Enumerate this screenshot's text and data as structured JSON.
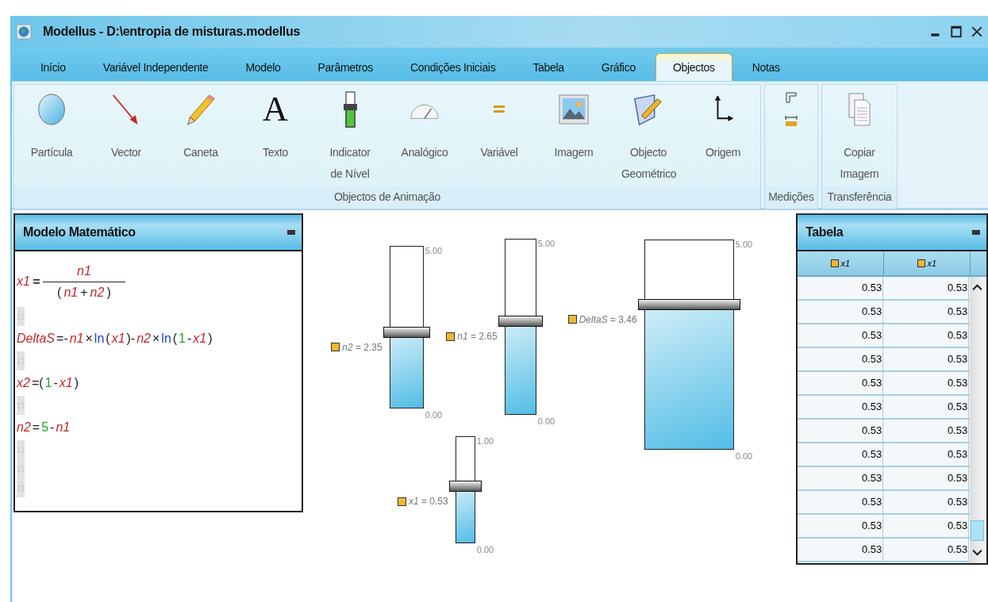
{
  "window": {
    "title": "Modellus - D:\\entropia de misturas.modellus"
  },
  "tabs": [
    {
      "label": "Início",
      "selected": false
    },
    {
      "label": "Variável Independente",
      "selected": false
    },
    {
      "label": "Modelo",
      "selected": false
    },
    {
      "label": "Parâmetros",
      "selected": false
    },
    {
      "label": "Condições Iniciais",
      "selected": false
    },
    {
      "label": "Tabela",
      "selected": false
    },
    {
      "label": "Gráfico",
      "selected": false
    },
    {
      "label": "Objectos",
      "selected": true
    },
    {
      "label": "Notas",
      "selected": false
    }
  ],
  "ribbon": [
    {
      "label": "Objectos de Animação",
      "items": [
        {
          "kind": "particle",
          "label": "Partícula"
        },
        {
          "kind": "vector",
          "label": "Vector"
        },
        {
          "kind": "pen",
          "label": "Caneta"
        },
        {
          "kind": "text",
          "label": "Texto",
          "glyph": "A"
        },
        {
          "kind": "level",
          "label": "Indicator de Nível"
        },
        {
          "kind": "gauge",
          "label": "Analógico"
        },
        {
          "kind": "variable",
          "label": "Variável"
        },
        {
          "kind": "image",
          "label": "Imagem"
        },
        {
          "kind": "geometry",
          "label": "Objecto Geométrico"
        },
        {
          "kind": "origin",
          "label": "Origem"
        }
      ]
    },
    {
      "label": "Medições",
      "items": [
        {
          "kind": "corner-ruler"
        },
        {
          "kind": "ruler"
        }
      ]
    },
    {
      "label": "Transferência",
      "items": [
        {
          "kind": "copy",
          "label": "Copiar Imagem"
        }
      ]
    }
  ],
  "model_panel": {
    "title": "Modelo Matemático",
    "lines": [
      {
        "kind": "fraction",
        "lhs": "x1",
        "numerator": [
          {
            "kind": "var",
            "text": "n1"
          }
        ],
        "denominator": [
          {
            "kind": "op",
            "text": "("
          },
          {
            "kind": "var",
            "text": "n1"
          },
          {
            "kind": "op",
            "text": "+"
          },
          {
            "kind": "var",
            "text": "n2"
          },
          {
            "kind": "op",
            "text": ")"
          }
        ]
      },
      {
        "kind": "blank"
      },
      {
        "kind": "line",
        "tokens": [
          {
            "kind": "var",
            "text": "DeltaS"
          },
          {
            "kind": "op",
            "text": "=-"
          },
          {
            "kind": "var",
            "text": "n1"
          },
          {
            "kind": "op",
            "text": "×"
          },
          {
            "kind": "fn",
            "text": "ln"
          },
          {
            "kind": "op",
            "text": "("
          },
          {
            "kind": "var",
            "text": "x1"
          },
          {
            "kind": "op",
            "text": ")-"
          },
          {
            "kind": "var",
            "text": "n2"
          },
          {
            "kind": "op",
            "text": "×"
          },
          {
            "kind": "fn",
            "text": "ln"
          },
          {
            "kind": "op",
            "text": "("
          },
          {
            "kind": "num",
            "text": "1"
          },
          {
            "kind": "op",
            "text": "-"
          },
          {
            "kind": "var",
            "text": "x1"
          },
          {
            "kind": "op",
            "text": ")"
          }
        ]
      },
      {
        "kind": "blank"
      },
      {
        "kind": "line",
        "tokens": [
          {
            "kind": "var",
            "text": "x2"
          },
          {
            "kind": "op",
            "text": "=("
          },
          {
            "kind": "num",
            "text": "1"
          },
          {
            "kind": "op",
            "text": "-"
          },
          {
            "kind": "var",
            "text": "x1"
          },
          {
            "kind": "op",
            "text": ")"
          }
        ]
      },
      {
        "kind": "blank"
      },
      {
        "kind": "line",
        "tokens": [
          {
            "kind": "var",
            "text": "n2"
          },
          {
            "kind": "op",
            "text": "="
          },
          {
            "kind": "num",
            "text": "5"
          },
          {
            "kind": "op",
            "text": "-"
          },
          {
            "kind": "var",
            "text": "n1"
          }
        ]
      },
      {
        "kind": "blank"
      },
      {
        "kind": "blank"
      },
      {
        "kind": "blank"
      }
    ]
  },
  "indicators": [
    {
      "reading": "*n2* = 2.35",
      "max": "5.00",
      "min": "0.00",
      "level": 0.47
    },
    {
      "reading": "*n1* = 2.65",
      "max": "5.00",
      "min": "0.00",
      "level": 0.53
    },
    {
      "reading": "*DeltaS* = 3.46",
      "max": "5.00",
      "min": "0.00",
      "level": 0.692
    },
    {
      "reading": "*x1* = 0.53",
      "max": "1.00",
      "min": "0.00",
      "level": 0.53
    }
  ],
  "table_panel": {
    "title": "Tabela",
    "columns": [
      "x1",
      "x1"
    ],
    "rows": [
      [
        "0.53",
        "0.53"
      ],
      [
        "0.53",
        "0.53"
      ],
      [
        "0.53",
        "0.53"
      ],
      [
        "0.53",
        "0.53"
      ],
      [
        "0.53",
        "0.53"
      ],
      [
        "0.53",
        "0.53"
      ],
      [
        "0.53",
        "0.53"
      ],
      [
        "0.53",
        "0.53"
      ],
      [
        "0.53",
        "0.53"
      ],
      [
        "0.53",
        "0.53"
      ],
      [
        "0.53",
        "0.53"
      ],
      [
        "0.53",
        "0.53"
      ]
    ]
  }
}
